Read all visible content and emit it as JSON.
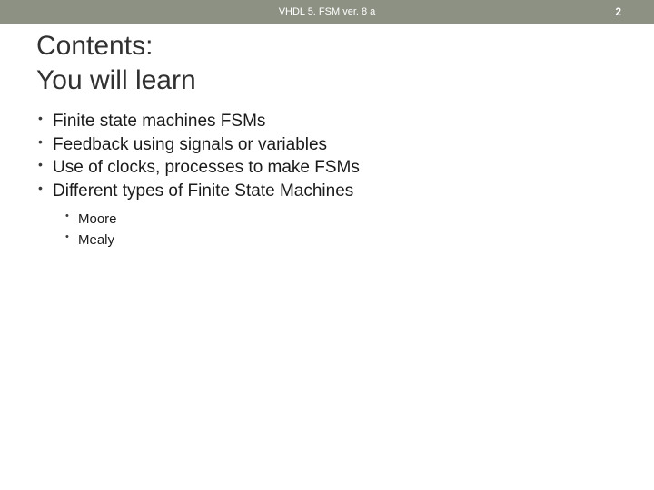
{
  "header": {
    "title": "VHDL 5. FSM ver. 8 a",
    "page_number": "2"
  },
  "slide": {
    "title_line1": "Contents:",
    "title_line2": "You will learn",
    "bullets": [
      "Finite state machines FSMs",
      "Feedback using signals or variables",
      "Use of clocks, processes to make FSMs",
      "Different types of Finite State Machines"
    ],
    "sub_bullets": [
      "Moore",
      "Mealy"
    ]
  }
}
